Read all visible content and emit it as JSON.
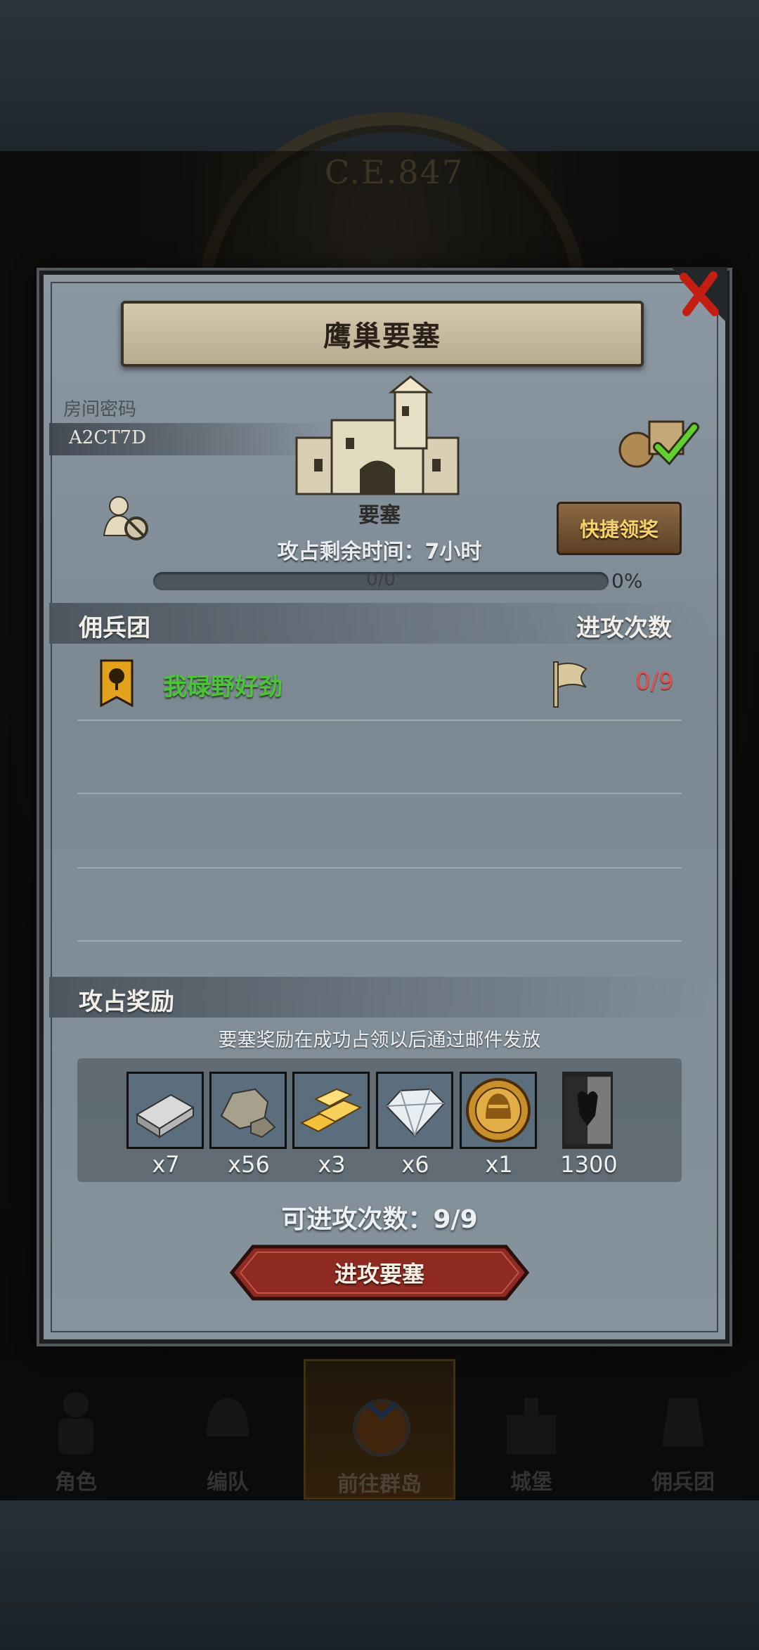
{
  "background": {
    "era_text": "C.E.847"
  },
  "dialog": {
    "title": "鹰巢要塞",
    "room_password_label": "房间密码",
    "room_code": "A2CT7D",
    "building_label": "要塞",
    "time_remaining": "攻占剩余时间：7小时",
    "quick_claim_label": "快捷领奖",
    "progress": {
      "text": "0/0",
      "percent_text": "0%",
      "fraction": 0
    },
    "mercenary_header": "佣兵团",
    "attack_count_header": "进攻次数",
    "mercenaries": [
      {
        "name": "我碌野好劲",
        "attacks": "0/9"
      }
    ],
    "reward_header": "攻占奖励",
    "reward_note": "要塞奖励在成功占领以后通过邮件发放",
    "rewards": [
      {
        "icon": "iron-ingot-icon",
        "qty": "x7"
      },
      {
        "icon": "stone-icon",
        "qty": "x56"
      },
      {
        "icon": "gold-bars-icon",
        "qty": "x3"
      },
      {
        "icon": "diamond-icon",
        "qty": "x6"
      },
      {
        "icon": "helmet-medal-icon",
        "qty": "x1"
      },
      {
        "icon": "minotaur-banner-icon",
        "qty": "1300"
      }
    ],
    "attempts_left": "可进攻次数：9/9",
    "attack_button": "进攻要塞"
  },
  "nav": {
    "items": [
      {
        "label": "角色"
      },
      {
        "label": "编队"
      },
      {
        "label": "前往群岛"
      },
      {
        "label": "城堡"
      },
      {
        "label": "佣兵团"
      }
    ]
  },
  "colors": {
    "accent_gold": "#f6d36a",
    "merc_name_green": "#4cc43a",
    "attack_count_red": "#e15050",
    "attack_button_red": "#8e2a22"
  }
}
